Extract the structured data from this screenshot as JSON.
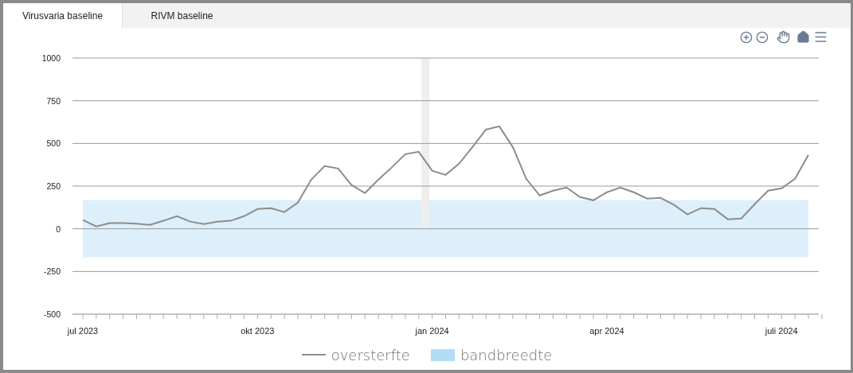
{
  "tabs": [
    {
      "label": "Virusvaria baseline",
      "selected": true
    },
    {
      "label": "RIVM baseline",
      "selected": false
    }
  ],
  "chart": {
    "chart_data": {
      "type": "line",
      "categories": [
        "jul 2023",
        null,
        null,
        null,
        null,
        null,
        null,
        null,
        null,
        null,
        null,
        null,
        null,
        "okt 2023",
        null,
        null,
        null,
        null,
        null,
        null,
        null,
        null,
        null,
        null,
        null,
        null,
        "jan 2024",
        null,
        null,
        null,
        null,
        null,
        null,
        null,
        null,
        null,
        null,
        null,
        null,
        "apr 2024",
        null,
        null,
        null,
        null,
        null,
        null,
        null,
        null,
        null,
        null,
        null,
        null,
        "juli 2024",
        null,
        null
      ],
      "ylim": [
        -500,
        1000
      ],
      "grid": true,
      "bands": [
        {
          "axis": "y",
          "from": -167,
          "to": 168,
          "label": "bandbreedte",
          "color": "#b3dcf5"
        }
      ],
      "yticks": [
        1000,
        750,
        500,
        250,
        0,
        -250,
        -500
      ],
      "series": [
        {
          "name": "oversterfte",
          "color": "#8c8c8c",
          "values": [
            51,
            14,
            33,
            33,
            30,
            23,
            47,
            74,
            42,
            28,
            42,
            47,
            74,
            116,
            121,
            98,
            153,
            288,
            367,
            353,
            256,
            209,
            288,
            360,
            437,
            451,
            340,
            316,
            381,
            479,
            581,
            600,
            479,
            293,
            195,
            223,
            242,
            186,
            167,
            214,
            242,
            214,
            177,
            181,
            140,
            84,
            121,
            116,
            56,
            60,
            144,
            223,
            237,
            293,
            433
          ]
        }
      ]
    }
  }
}
